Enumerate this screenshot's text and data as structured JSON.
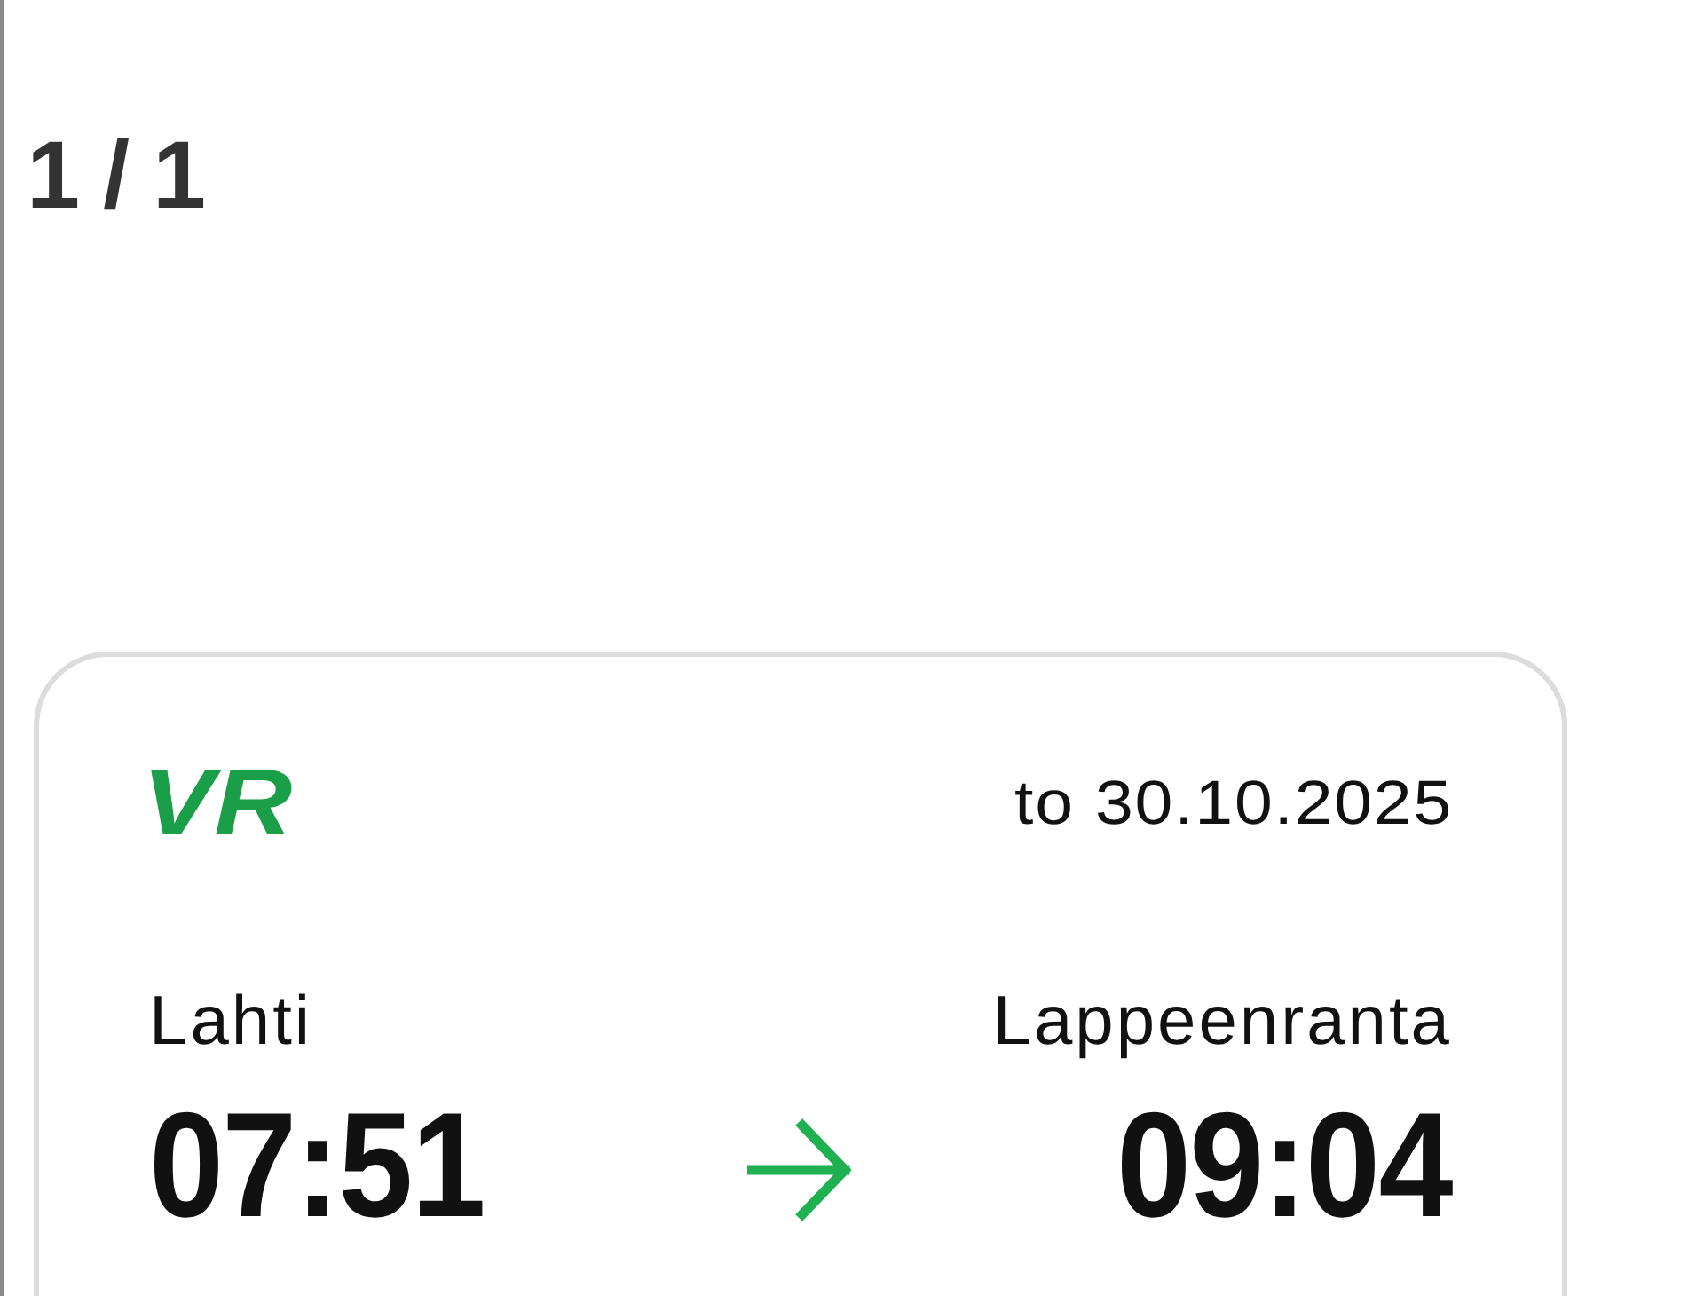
{
  "page_indicator": "1 / 1",
  "ticket": {
    "logo": "VR",
    "date": "to 30.10.2025",
    "departure": {
      "station": "Lahti",
      "time": "07:51"
    },
    "arrival": {
      "station": "Lappeenranta",
      "time": "09:04"
    }
  }
}
